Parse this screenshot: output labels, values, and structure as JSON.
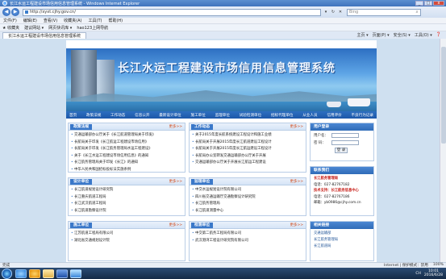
{
  "window": {
    "title": "长江水运工程建设市场信用信息管理系统 - Windows Internet Explorer",
    "controls": [
      "_",
      "□",
      "x"
    ]
  },
  "addressbar": {
    "back": "◀",
    "forward": "▶",
    "url": "http://xyxt.cjhy.gov.cn/",
    "tools": [
      "▾",
      "↻",
      "✕"
    ],
    "search_text": "Bing",
    "search_icon": "magnifier-icon"
  },
  "menubar": [
    "文件(F)",
    "编辑(E)",
    "查看(V)",
    "收藏夹(A)",
    "工具(T)",
    "帮助(H)"
  ],
  "favorites": {
    "label": "收藏夹",
    "items": [
      "建议网站 ▾",
      "网页快讯库 ▾",
      "hao123上网导航"
    ]
  },
  "tabs": {
    "active": "长江水运工程建设市场信用信息管理系统",
    "tools": [
      "主页 ▾",
      "页面(P) ▾",
      "安全(S) ▾",
      "工具(O) ▾",
      "❓"
    ]
  },
  "banner": {
    "title": "长江水运工程建设市场信用信息管理系统"
  },
  "nav": [
    "首页",
    "政策法规",
    "工作动态",
    "信息公开",
    "最新设计单位",
    "施工单位",
    "监理单位",
    "试验检测单位",
    "招标代理单位",
    "从业人员",
    "信用评价",
    "不良行为记录"
  ],
  "news": {
    "title": "政策法规",
    "more": "更多>>",
    "items": [
      "交通运输部办公厅关于《长江航道管理局关于印发》",
      "长航局关于印发《长江航运工程建设市场信用》",
      "长航局关于印发《长江航务管理局水运工程建设》",
      "关于《长江水运工程建设市场信用信息》的通知",
      "长江航务管理局关于印发《长江》的通知",
      "中华人民共和国招标投标法实施条例"
    ]
  },
  "work": {
    "title": "工作动态",
    "more": "更多>>",
    "items": [
      "关于2015年度长航系统建设工程设计和施工业绩",
      "长航局关于开展2015年度长江航道建设工程设计",
      "长航局关于开展2015年度长江航运建设工程设计",
      "长航局办公室转发交通运输部办公厅关于开展",
      "交通运输部办公厅关于开展长江航运工程建设"
    ]
  },
  "design": {
    "title": "设计单位",
    "more": "更多>>",
    "items": [
      "长江航道规划设计研究院",
      "长江重庆航道工程局",
      "长江武汉航道工程局",
      "长江航道勘察设计院"
    ]
  },
  "supervision": {
    "title": "监理单位",
    "more": "更多>>",
    "items": [
      "中交水运规划设计院有限公司",
      "四川省交通运输厅交通勘察设计研究院",
      "长江航务管理局",
      "长江航道测量中心"
    ]
  },
  "construction": {
    "title": "施工单位",
    "more": "更多>>",
    "items": [
      "江苏航道工程局有限公司",
      "湖北省交通规划设计院"
    ]
  },
  "testing": {
    "title": "检测单位",
    "more": "更多>>",
    "items": [
      "中交第二航务工程局有限公司",
      "武汉港湾工程设计研究院有限公司"
    ]
  },
  "login": {
    "title": "用户登录",
    "user_label": "用户名：",
    "pass_label": "密 码：",
    "button": "登 录"
  },
  "contact": {
    "title": "联系我们",
    "org": "长江航务管理局",
    "phone1": "电话：027-82767182",
    "support": "技术支持：长江航务信息中心",
    "phone2": "电话：027-82767186",
    "email": "邮箱：yb0986@cjhy.com.cn"
  },
  "links": {
    "title": "相关链接",
    "items": [
      "交通运输部",
      "长江航务管理局",
      "长江航道局"
    ]
  },
  "statusbar": {
    "left": "完成",
    "zone": "Internet | 保护模式：禁用",
    "zoom": "100%"
  },
  "taskbar": {
    "tray_lang": "CH",
    "time": "10:01",
    "date": "2016/6/28"
  }
}
